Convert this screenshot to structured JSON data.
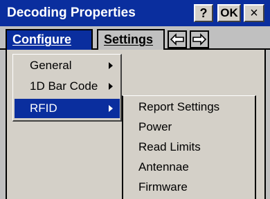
{
  "window": {
    "title": "Decoding Properties",
    "help_label": "?",
    "ok_label": "OK",
    "close_label": "×"
  },
  "tabs": {
    "configure": "Configure",
    "settings": "Settings",
    "prev_icon": "left-arrow-icon",
    "next_icon": "right-arrow-icon"
  },
  "menu": {
    "items": [
      {
        "label": "General",
        "has_submenu": true
      },
      {
        "label": "1D Bar Code",
        "has_submenu": true
      },
      {
        "label": "RFID",
        "has_submenu": true,
        "selected": true
      }
    ]
  },
  "submenu": {
    "items": [
      "Report Settings",
      "Power",
      "Read Limits",
      "Antennae",
      "Firmware"
    ]
  },
  "colors": {
    "titlebar": "#0a2e9e",
    "highlight": "#0a2e9e",
    "face": "#d4d0c8",
    "background": "#c0c0c0"
  }
}
